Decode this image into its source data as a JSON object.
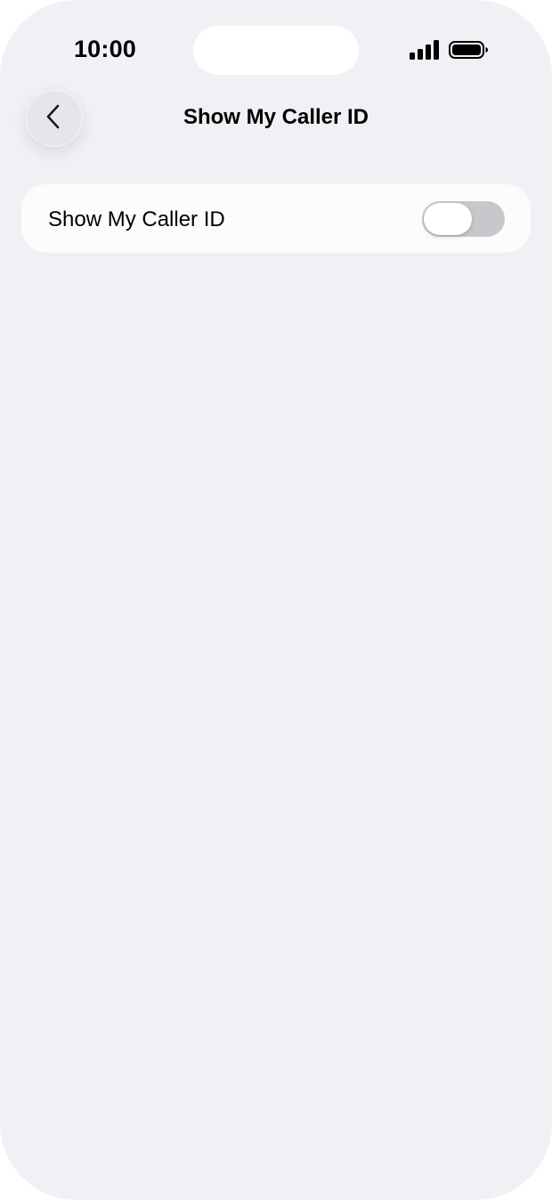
{
  "status_bar": {
    "time": "10:00",
    "signal_icon": "cellular-signal-icon",
    "battery_icon": "battery-full-icon"
  },
  "nav": {
    "back_icon": "chevron-left-icon",
    "title": "Show My Caller ID"
  },
  "settings": {
    "rows": [
      {
        "label": "Show My Caller ID",
        "toggle_on": false
      }
    ]
  },
  "colors": {
    "background": "#f0f0f5",
    "group_background": "#fcfcfd",
    "toggle_off_track": "#c7c7cc",
    "toggle_knob": "#ffffff"
  }
}
